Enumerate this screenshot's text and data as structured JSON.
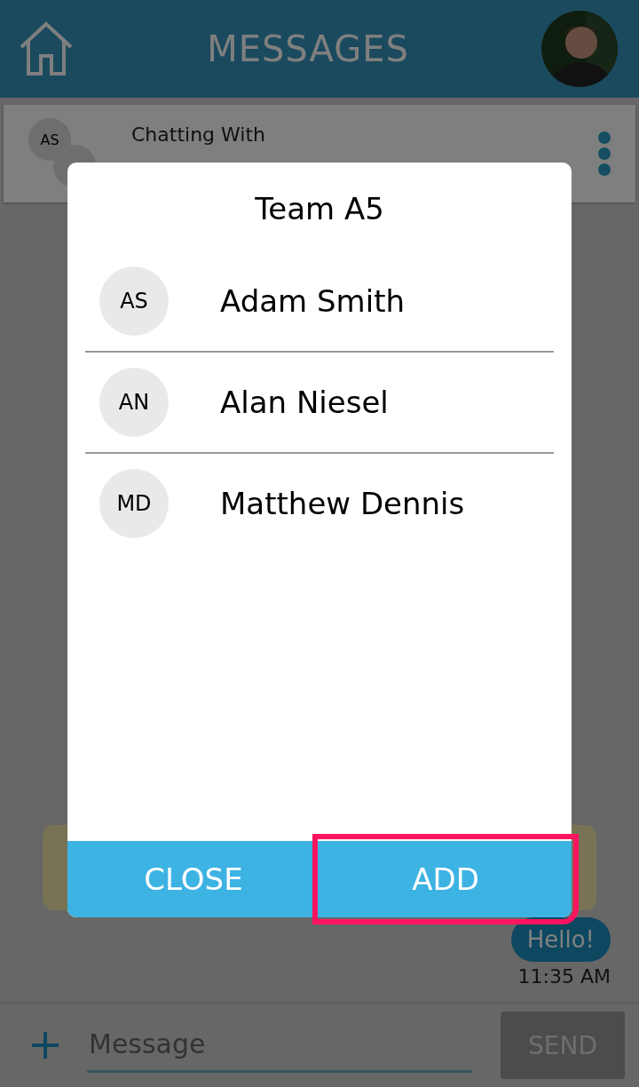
{
  "header": {
    "title": "MESSAGES"
  },
  "chat_header": {
    "label": "Chatting With",
    "avatars": [
      {
        "kind": "shown",
        "initials": "AS"
      },
      {
        "kind": "covered"
      }
    ]
  },
  "messages": [
    {
      "kind": "hidden"
    },
    {
      "kind": "sent",
      "text": "Hello!",
      "time": "11:35 AM"
    }
  ],
  "composer": {
    "placeholder": "Message",
    "send": "SEND",
    "send_disabled": true
  },
  "dialog": {
    "title": "Team A5",
    "members": [
      {
        "initials": "AS",
        "name": "Adam Smith"
      },
      {
        "initials": "AN",
        "name": "Alan Niesel"
      },
      {
        "initials": "MD",
        "name": "Matthew Dennis"
      }
    ],
    "buttons": [
      {
        "label": "CLOSE",
        "highlighted": false
      },
      {
        "label": "ADD",
        "highlighted": true
      }
    ]
  }
}
